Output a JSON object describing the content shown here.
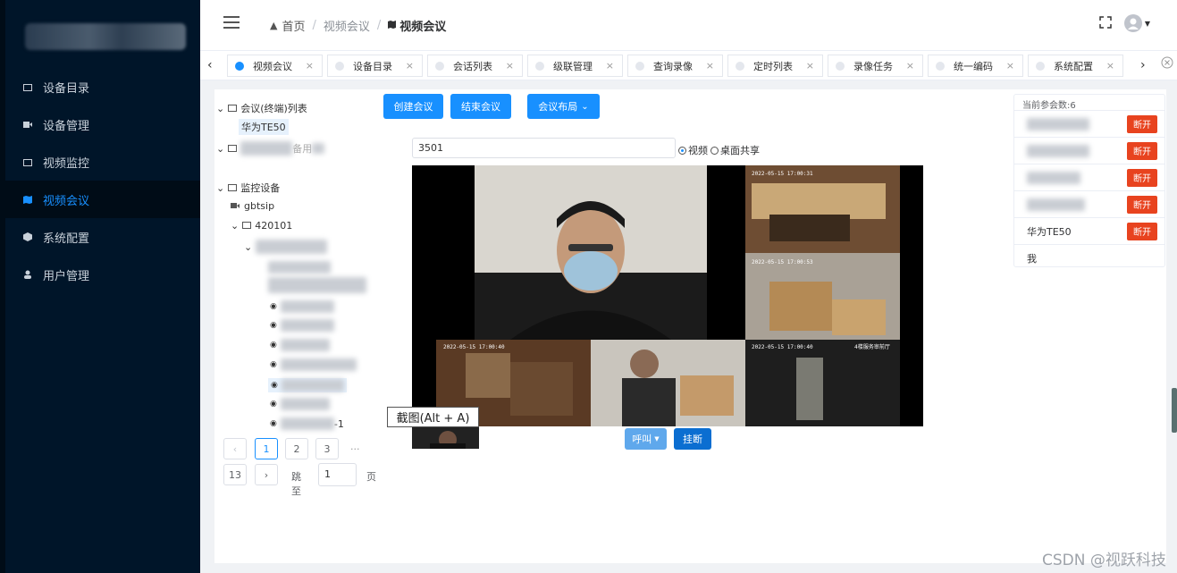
{
  "sidebar": {
    "items": [
      {
        "label": "设备目录",
        "icon": "folder-icon"
      },
      {
        "label": "设备管理",
        "icon": "camera-icon"
      },
      {
        "label": "视频监控",
        "icon": "folder-icon"
      },
      {
        "label": "视频会议",
        "icon": "map-icon",
        "active": true
      },
      {
        "label": "系统配置",
        "icon": "cube-icon"
      },
      {
        "label": "用户管理",
        "icon": "user-icon"
      }
    ]
  },
  "header": {
    "breadcrumb": {
      "home": "首页",
      "parent": "视频会议",
      "current": "视频会议"
    }
  },
  "tabs": [
    {
      "label": "视频会议",
      "active": true
    },
    {
      "label": "设备目录"
    },
    {
      "label": "会话列表"
    },
    {
      "label": "级联管理"
    },
    {
      "label": "查询录像"
    },
    {
      "label": "定时列表"
    },
    {
      "label": "录像任务"
    },
    {
      "label": "统一编码"
    },
    {
      "label": "系统配置"
    }
  ],
  "tree": {
    "conference_root": "会议(终端)列表",
    "conference_child": "华为TE50",
    "second_root_suffix": "备用",
    "monitor_root": "监控设备",
    "monitor_child1": "gbtsip",
    "monitor_child2": "420101",
    "suffix_row": "-1"
  },
  "toolbar": {
    "create": "创建会议",
    "end": "结束会议",
    "layout": "会议布局"
  },
  "conference": {
    "number_value": "3501",
    "radio_video": "视频",
    "radio_desktop": "桌面共享",
    "call_button": "呼叫",
    "hangup_button": "挂断"
  },
  "pagination": {
    "pages": [
      "1",
      "2",
      "3"
    ],
    "ellipsis": "···",
    "last_page": "13",
    "goto_label": "跳至",
    "goto_value": "1",
    "page_unit": "页",
    "current": 1
  },
  "tooltip": {
    "text": "截图(Alt + A)"
  },
  "participants": {
    "title": "当前参会数:6",
    "rows": [
      {
        "name": "",
        "action": "断开"
      },
      {
        "name": "",
        "action": "断开"
      },
      {
        "name": "",
        "action": "断开"
      },
      {
        "name": "",
        "action": "断开"
      },
      {
        "name": "华为TE50",
        "action": "断开"
      },
      {
        "name": "我",
        "action": ""
      }
    ]
  },
  "video_overlays": {
    "tile2": "2022-05-15 17:00:31",
    "tile3": "2022-05-15 17:00:53",
    "tile4": "2022-05-15 17:00:40",
    "tile6": "2022-05-15 17:00:40",
    "tile6_label": "4楼服务审前厅"
  },
  "watermark": "CSDN @视跃科技",
  "colors": {
    "sidebar_bg": "#001529",
    "accent": "#1890ff",
    "disconnect": "#e8431f"
  }
}
